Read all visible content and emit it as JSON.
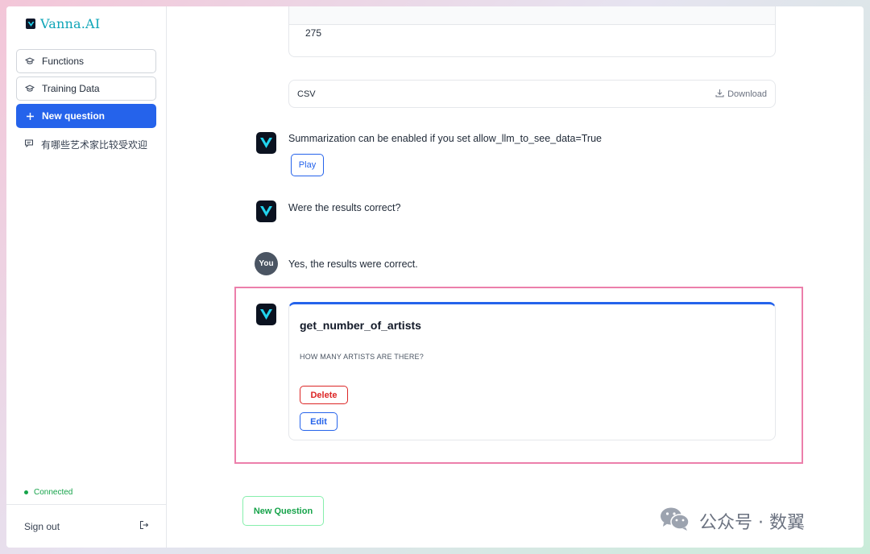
{
  "brand": {
    "name": "Vanna.AI"
  },
  "sidebar": {
    "items": [
      {
        "label": "Functions",
        "icon": "graduation-cap-icon"
      },
      {
        "label": "Training Data",
        "icon": "graduation-cap-icon"
      },
      {
        "label": "New question",
        "icon": "plus-icon"
      }
    ],
    "history": [
      {
        "label": "有哪些艺术家比较受欢迎",
        "icon": "chat-bubble-icon"
      }
    ],
    "status": "Connected",
    "sign_out": "Sign out"
  },
  "chat": {
    "table_value": "275",
    "csv_label": "CSV",
    "download_label": "Download",
    "summary_text": "Summarization can be enabled if you set allow_llm_to_see_data=True",
    "play_label": "Play",
    "question_text": "Were the results correct?",
    "user_avatar": "You",
    "user_reply": "Yes, the results were correct.",
    "function_card": {
      "name": "get_number_of_artists",
      "description": "HOW MANY ARTISTS ARE THERE?",
      "delete_label": "Delete",
      "edit_label": "Edit"
    },
    "new_question_label": "New Question"
  },
  "watermark": {
    "text": "公众号 · 数翼"
  },
  "colors": {
    "accent": "#2563eb",
    "danger": "#dc2626",
    "success": "#16a34a",
    "highlight": "#ec7fab"
  }
}
